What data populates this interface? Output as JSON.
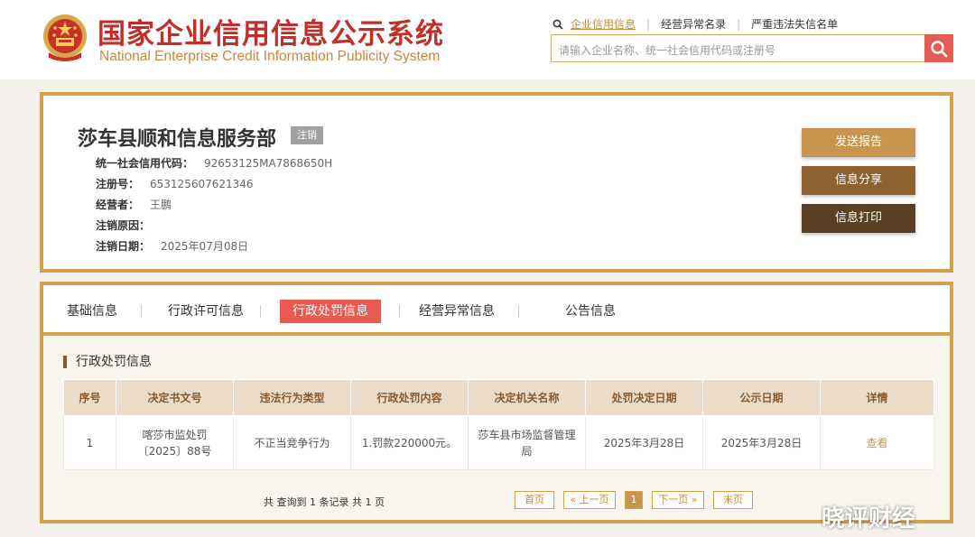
{
  "header": {
    "title": "国家企业信用信息公示系统",
    "subtitle": "National Enterprise Credit Information Publicity System",
    "nav_links": [
      "企业信用信息",
      "经营异常名录",
      "严重违法失信名单"
    ],
    "search_placeholder": "请输入企业名称、统一社会信用代码或注册号"
  },
  "company": {
    "name": "莎车县顺和信息服务部",
    "status": "注销",
    "fields": [
      {
        "label": "统一社会信用代码：",
        "value": "92653125MA7868650H"
      },
      {
        "label": "注册号：",
        "value": "653125607621346"
      },
      {
        "label": "经营者：",
        "value": "王鹏"
      },
      {
        "label": "注销原因：",
        "value": ""
      },
      {
        "label": "注销日期：",
        "value": "2025年07月08日"
      }
    ],
    "actions": [
      "发送报告",
      "信息分享",
      "信息打印"
    ]
  },
  "tabs": [
    "基础信息",
    "行政许可信息",
    "行政处罚信息",
    "经营异常信息",
    "公告信息"
  ],
  "active_tab": "行政处罚信息",
  "section_title": "行政处罚信息",
  "table": {
    "headers": [
      "序号",
      "决定书文号",
      "违法行为类型",
      "行政处罚内容",
      "决定机关名称",
      "处罚决定日期",
      "公示日期",
      "详情"
    ],
    "rows": [
      [
        "1",
        "喀莎市监处罚〔2025〕88号",
        "不正当竞争行为",
        "1.罚款220000元。",
        "莎车县市场监督管理局",
        "2025年3月28日",
        "2025年3月28日",
        "查看"
      ]
    ]
  },
  "pagination": {
    "total_text": "共 查询到 1 条记录 共 1 页",
    "first": "首页",
    "prev": "« 上一页",
    "current": "1",
    "next": "下一页 »",
    "last": "末页"
  },
  "watermark": "晓评财经",
  "colors": {
    "brand_red": "#c0302b",
    "gold_border": "#d2a24b",
    "active_tab": "#e85a52",
    "table_header_bg": "#ebdcca",
    "btn_report": "#c8954e",
    "btn_share": "#8e6230",
    "btn_print": "#5a4020"
  }
}
